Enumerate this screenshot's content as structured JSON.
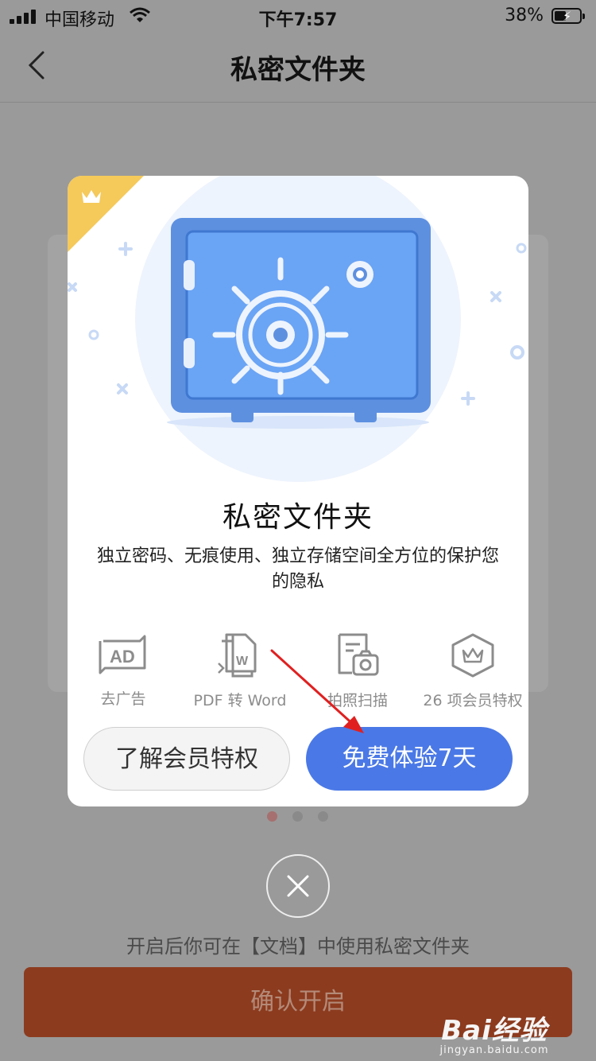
{
  "status_bar": {
    "carrier": "中国移动",
    "time": "下午7:57",
    "battery_percent": "38%",
    "battery_level": 0.38,
    "charging": true
  },
  "nav": {
    "title": "私密文件夹",
    "back_icon": "chevron-left-icon"
  },
  "modal": {
    "title": "私密文件夹",
    "description": "独立密码、无痕使用、独立存储空间全方位的保护您的隐私",
    "corner_icon": "crown-icon",
    "illustration": "safe-illustration",
    "features": [
      {
        "icon": "ad-icon",
        "label": "去广告"
      },
      {
        "icon": "pdf-word-icon",
        "label": "PDF 转 Word"
      },
      {
        "icon": "camera-scan-icon",
        "label": "拍照扫描"
      },
      {
        "icon": "crown-badge-icon",
        "label": "26 项会员特权"
      }
    ],
    "learn_button": "了解会员特权",
    "trial_button": "免费体验7天"
  },
  "pager": {
    "count": 3,
    "active_index": 0
  },
  "close_icon": "close-icon",
  "hint": "开启后你可在【文档】中使用私密文件夹",
  "confirm_button": "确认开启",
  "watermark": {
    "logo": "Bai经验",
    "url": "jingyan.baidu.com"
  },
  "colors": {
    "overlay": "#9a9a9a",
    "primary_blue": "#4a78e6",
    "confirm_bg": "#8c3b1f",
    "crown_gold": "#f5c95a",
    "safe_blue": "#6aa4f5"
  }
}
